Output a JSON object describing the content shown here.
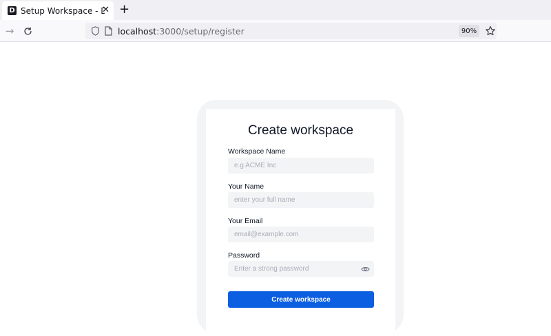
{
  "browser": {
    "tab": {
      "favicon_letter": "D",
      "title": "Setup Workspace - Documenso",
      "close": "✕"
    },
    "new_tab": "+",
    "nav": {
      "forward": "→",
      "reload": "⟳"
    },
    "url": {
      "host": "localhost",
      "path": ":3000/setup/register"
    },
    "zoom": "90%"
  },
  "form": {
    "title": "Create workspace",
    "fields": [
      {
        "label": "Workspace Name",
        "placeholder": "e.g ACME Inc"
      },
      {
        "label": "Your Name",
        "placeholder": "enter your full name"
      },
      {
        "label": "Your Email",
        "placeholder": "email@example.com"
      },
      {
        "label": "Password",
        "placeholder": "Enter a strong password"
      }
    ],
    "submit_label": "Create workspace"
  },
  "colors": {
    "accent": "#0c5fe0",
    "input_bg": "#f3f4f6",
    "card_border": "#f3f4f6"
  }
}
